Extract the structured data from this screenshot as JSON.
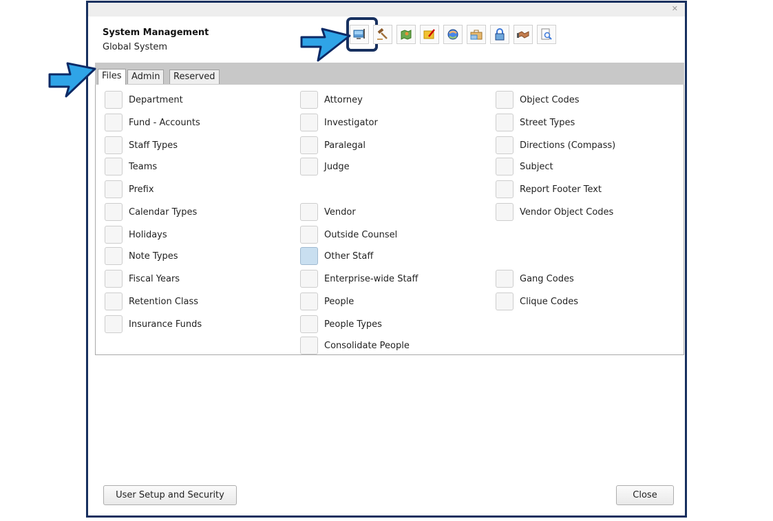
{
  "window": {
    "close_glyph": "✕",
    "title": "System Management",
    "subtitle": "Global System"
  },
  "toolbar": {
    "icons": [
      "monitor-flag-icon",
      "gavel-icon",
      "map-icon",
      "folder-edit-icon",
      "globe-refresh-icon",
      "briefcase-icon",
      "padlock-icon",
      "handshake-icon",
      "document-search-icon"
    ],
    "highlighted_index": 0
  },
  "tabs": [
    {
      "label": "Files",
      "active": true
    },
    {
      "label": "Admin",
      "active": false
    },
    {
      "label": "Reserved",
      "active": false
    }
  ],
  "columns": [
    [
      {
        "label": "Department"
      },
      {
        "label": "Fund - Accounts"
      },
      {
        "label": "Staff Types"
      },
      {
        "label": "Teams"
      },
      {
        "label": "Prefix"
      },
      {
        "label": "Calendar Types"
      },
      {
        "label": "Holidays"
      },
      {
        "label": "Note Types"
      },
      {
        "label": "Fiscal Years"
      },
      {
        "label": "Retention Class"
      },
      {
        "label": "Insurance Funds"
      }
    ],
    [
      {
        "label": "Attorney"
      },
      {
        "label": "Investigator"
      },
      {
        "label": "Paralegal"
      },
      {
        "label": "Judge"
      },
      {
        "label": "Vendor"
      },
      {
        "label": "Outside Counsel"
      },
      {
        "label": "Other Staff",
        "checked": true
      },
      {
        "label": "Enterprise-wide Staff"
      },
      {
        "label": "People"
      },
      {
        "label": "People Types"
      },
      {
        "label": "Consolidate People"
      }
    ],
    [
      {
        "label": "Object Codes"
      },
      {
        "label": "Street Types"
      },
      {
        "label": "Directions (Compass)"
      },
      {
        "label": "Subject"
      },
      {
        "label": "Report Footer Text"
      },
      {
        "label": "Vendor Object Codes"
      },
      {
        "label": "Gang Codes"
      },
      {
        "label": "Clique Codes"
      }
    ]
  ],
  "footer": {
    "user_setup_label": "User Setup and Security",
    "close_label": "Close"
  },
  "colors": {
    "frame_border": "#17305f",
    "callout_arrow": "#2fa4e7",
    "tab_strip": "#c8c8c8"
  }
}
